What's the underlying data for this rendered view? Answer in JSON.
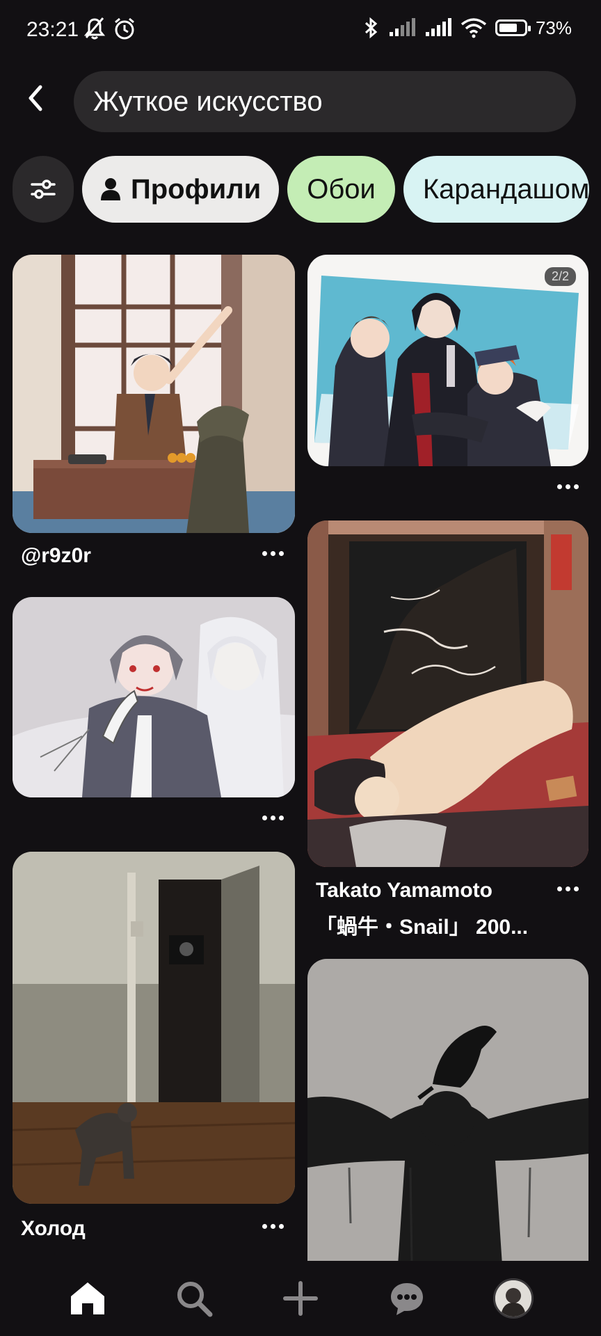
{
  "status_bar": {
    "time": "23:21",
    "battery": "73%",
    "battery_level": 0.73
  },
  "search": {
    "query": "Жуткое искусство"
  },
  "chips": [
    {
      "label": "Профили",
      "bg": "#ecebea"
    },
    {
      "label": "Обои",
      "bg": "#c4edb5"
    },
    {
      "label": "Карандашом",
      "bg": "#d8f3f3"
    }
  ],
  "pins": {
    "p1": {
      "caption": "@r9z0r"
    },
    "p2": {
      "badge": "2/2"
    },
    "p4": {
      "caption_line1": "Takato Yamamoto",
      "caption_line2": "「蝸牛・Snail」 200..."
    },
    "p5": {
      "caption": "Холод"
    }
  },
  "nav": [
    "home-icon",
    "search-icon",
    "create-icon",
    "messages-icon",
    "profile-avatar"
  ],
  "colors": {
    "background": "#121013",
    "surface": "#2b292b"
  }
}
